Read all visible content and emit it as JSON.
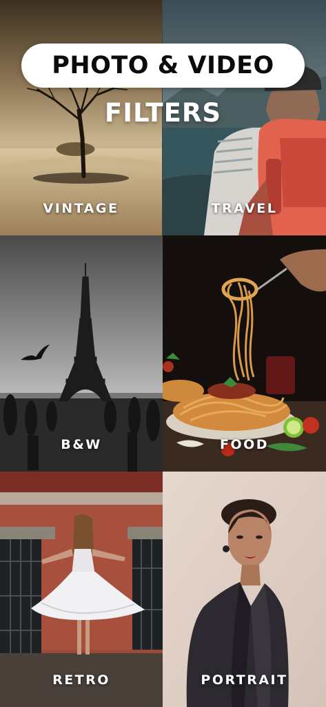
{
  "header": {
    "title_line1": "PHOTO & VIDEO",
    "title_line2": "FILTERS"
  },
  "filters": [
    {
      "label": "VINTAGE",
      "subject": "lone tree on sandy plain"
    },
    {
      "label": "TRAVEL",
      "subject": "hiker with red backpack by lake"
    },
    {
      "label": "B&W",
      "subject": "Eiffel Tower with bird in flight"
    },
    {
      "label": "FOOD",
      "subject": "spaghetti twirled on fork"
    },
    {
      "label": "RETRO",
      "subject": "woman in white dress before red wall"
    },
    {
      "label": "PORTRAIT",
      "subject": "woman in dark blazer"
    }
  ],
  "colors": {
    "pill_bg": "#ffffff",
    "pill_text": "#0b0b0b",
    "label_text": "#ffffff"
  }
}
